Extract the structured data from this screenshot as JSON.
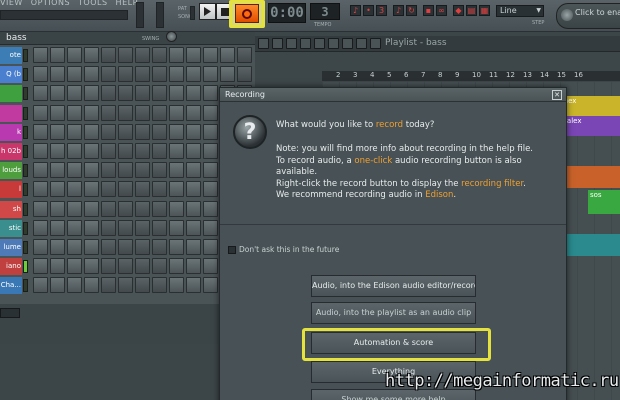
{
  "menu": [
    "VIEW",
    "OPTIONS",
    "TOOLS",
    "HELP"
  ],
  "transport": {
    "pat_label": "PAT",
    "song_label": "SONG",
    "time": "0:00",
    "tempo_value": "3",
    "tempo_label": "TEMPO"
  },
  "toolbar": {
    "snap_value": "Line",
    "snap_label": "STEP",
    "enable_button": "Click to enable"
  },
  "channel_rack": {
    "title": "bass",
    "swing_label": "SWING",
    "channels": [
      {
        "name": "ote",
        "color": "#3d7db5"
      },
      {
        "name": "Q (b",
        "color": "#4a7fcf"
      },
      {
        "name": "",
        "color": "#3ea03e"
      },
      {
        "name": "",
        "color": "#c03aa0"
      },
      {
        "name": "k",
        "color": "#b93ab0"
      },
      {
        "name": "h 02b",
        "color": "#c8366a"
      },
      {
        "name": "louds",
        "color": "#4f9e3e"
      },
      {
        "name": "l",
        "color": "#c83a3a"
      },
      {
        "name": "sh",
        "color": "#d04848"
      },
      {
        "name": "stic",
        "color": "#3a8e8e"
      },
      {
        "name": "lume",
        "color": "#4f7ab8"
      },
      {
        "name": "iano",
        "color": "#c04040"
      },
      {
        "name": "Cha...",
        "color": "#3a78b5"
      }
    ]
  },
  "playlist": {
    "title": "Playlist - bass",
    "ruler": [
      "2",
      "3",
      "4",
      "5",
      "6",
      "7",
      "8",
      "9",
      "10",
      "11",
      "12",
      "13",
      "14",
      "15",
      "16"
    ],
    "clips": [
      {
        "label": "snex",
        "color": "#c9b42a"
      },
      {
        "label": "fgalex",
        "color": "#7a45b5"
      },
      {
        "label": "",
        "color": "#c9622a"
      },
      {
        "label": "sos",
        "color": "#3aa840"
      },
      {
        "label": "",
        "color": "#2a8a8e"
      }
    ]
  },
  "dialog": {
    "title": "Recording",
    "question_prefix": "What would you like to ",
    "question_highlight": "record",
    "question_suffix": " today?",
    "info": [
      {
        "pre": "Note: you will find more info about recording in the help file.",
        "hl": "",
        "post": ""
      },
      {
        "pre": "To record audio, a ",
        "hl": "one-click",
        "post": " audio recording button is also available."
      },
      {
        "pre": "Right-click the record button to display the ",
        "hl": "recording filter",
        "post": "."
      },
      {
        "pre": "We recommend recording audio in ",
        "hl": "Edison",
        "post": "."
      }
    ],
    "dont_ask": "Don't ask this in the future",
    "buttons": [
      "Audio, into the Edison audio editor/recorder",
      "Audio, into the playlist as an audio clip",
      "Automation & score",
      "Everything",
      "Show me some more help"
    ]
  },
  "watermark": "http://megainformatic.ru"
}
